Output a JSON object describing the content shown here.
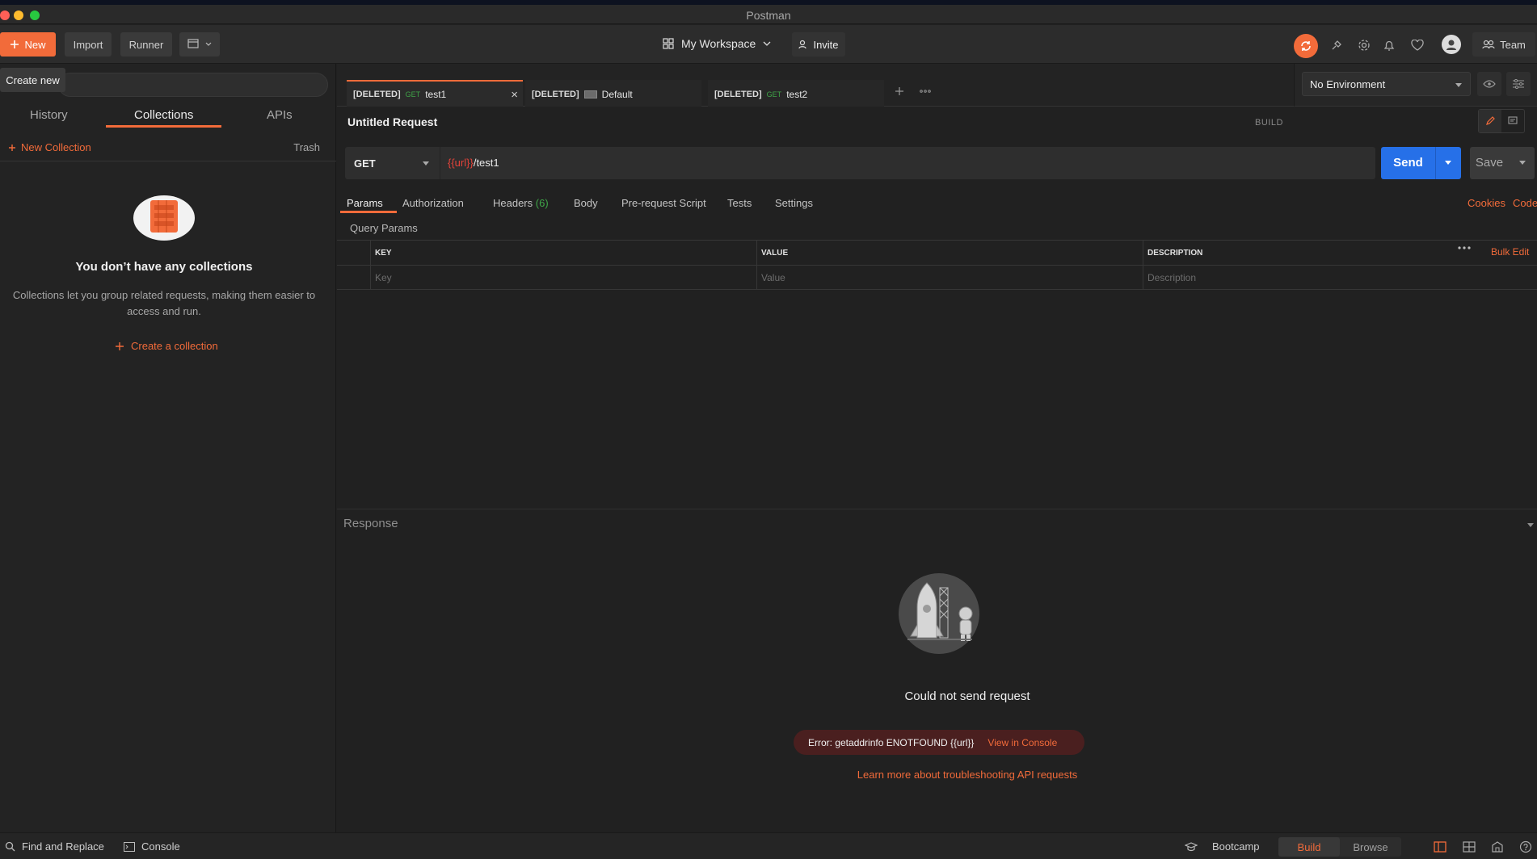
{
  "app": {
    "title": "Postman"
  },
  "header": {
    "new_label": "New",
    "import_label": "Import",
    "runner_label": "Runner",
    "workspace_label": "My Workspace",
    "invite_label": "Invite",
    "team_label": "Team",
    "accent_color": "#f26b3a"
  },
  "sidebar": {
    "tooltip": "Create new",
    "tabs": [
      {
        "label": "History"
      },
      {
        "label": "Collections"
      },
      {
        "label": "APIs"
      }
    ],
    "active_tab": "Collections",
    "new_collection_label": "New Collection",
    "trash_label": "Trash",
    "empty_title": "You don’t have any collections",
    "empty_desc": "Collections let you group related requests, making them easier to access and run.",
    "create_collection_label": "Create a collection"
  },
  "request_tabs": [
    {
      "deleted": "[DELETED]",
      "method": "GET",
      "name": "test1",
      "active": true
    },
    {
      "deleted": "[DELETED]",
      "method": "",
      "name": "Default",
      "active": false
    },
    {
      "deleted": "[DELETED]",
      "method": "GET",
      "name": "test2",
      "active": false
    }
  ],
  "environment": {
    "selected": "No Environment"
  },
  "request": {
    "title": "Untitled Request",
    "mode_label": "BUILD",
    "method": "GET",
    "url_var": "{{url}}",
    "url_path": "/test1",
    "send_label": "Send",
    "save_label": "Save",
    "tabs": [
      {
        "label": "Params"
      },
      {
        "label": "Authorization"
      },
      {
        "label": "Headers",
        "count": "(6)"
      },
      {
        "label": "Body"
      },
      {
        "label": "Pre-request Script"
      },
      {
        "label": "Tests"
      },
      {
        "label": "Settings"
      }
    ],
    "active_tab": "Params",
    "cookies_label": "Cookies",
    "code_label": "Code",
    "query_params_label": "Query Params",
    "columns": {
      "key": "KEY",
      "value": "VALUE",
      "description": "DESCRIPTION"
    },
    "placeholders": {
      "key": "Key",
      "value": "Value",
      "description": "Description"
    },
    "bulk_edit_label": "Bulk Edit"
  },
  "response": {
    "label": "Response",
    "title": "Could not send request",
    "error_text": "Error: getaddrinfo ENOTFOUND {{url}}",
    "view_console_label": "View in Console",
    "learn_more_label": "Learn more about troubleshooting API requests"
  },
  "footer": {
    "find_replace_label": "Find and Replace",
    "console_label": "Console",
    "bootcamp_label": "Bootcamp",
    "build_label": "Build",
    "browse_label": "Browse"
  }
}
